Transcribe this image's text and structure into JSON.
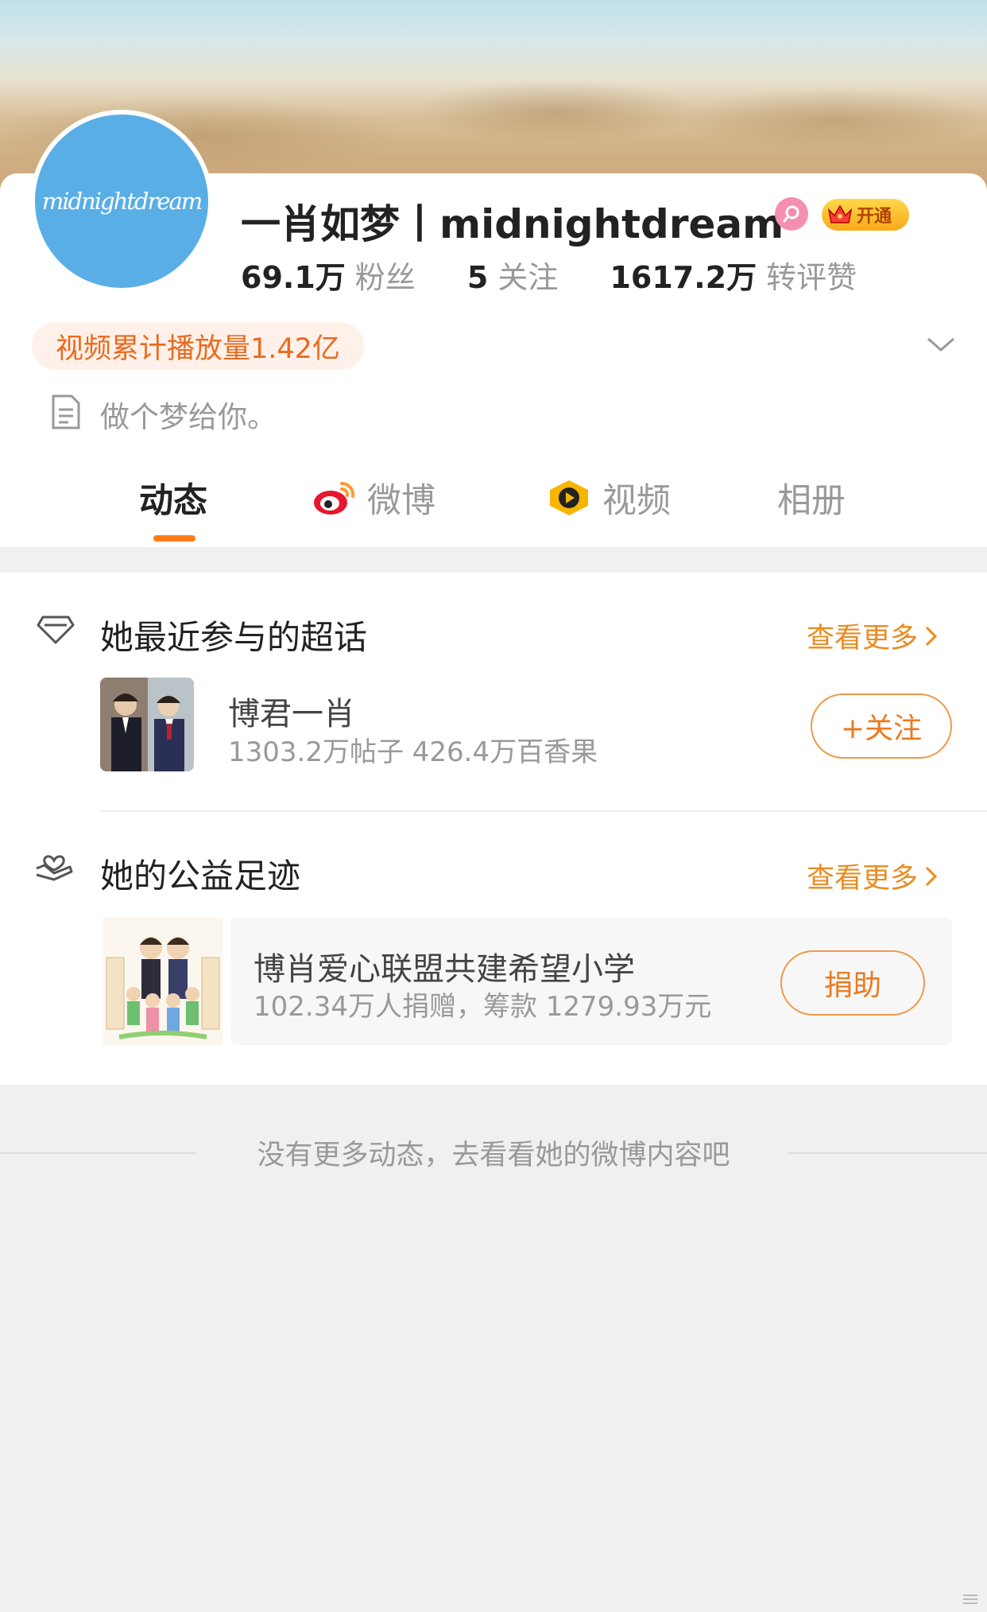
{
  "profile": {
    "avatar_text": "midnightdream",
    "username": "一肖如梦丨midnightdream",
    "gender_icon": "female-icon",
    "vip_label": "开通",
    "stats": [
      {
        "value": "69.1万",
        "label": "粉丝"
      },
      {
        "value": "5",
        "label": "关注"
      },
      {
        "value": "1617.2万",
        "label": "转评赞"
      }
    ],
    "video_views": "视频累计播放量1.42亿",
    "bio": "做个梦给你。"
  },
  "tabs": [
    {
      "label": "动态",
      "icon": null,
      "active": true
    },
    {
      "label": "微博",
      "icon": "weibo-icon",
      "active": false
    },
    {
      "label": "视频",
      "icon": "video-play-icon",
      "active": false
    },
    {
      "label": "相册",
      "icon": null,
      "active": false
    }
  ],
  "super_topic": {
    "title": "她最近参与的超话",
    "see_more": "查看更多",
    "name": "博君一肖",
    "stats": "1303.2万帖子  426.4万百香果",
    "follow_label": "+关注"
  },
  "charity": {
    "title": "她的公益足迹",
    "see_more": "查看更多",
    "name": "博肖爱心联盟共建希望小学",
    "stats": "102.34万人捐赠，筹款 1279.93万元",
    "donate_label": "捐助"
  },
  "footer": {
    "text": "没有更多动态，去看看她的微博内容吧"
  },
  "colors": {
    "accent": "#ff7d1a",
    "link": "#ea8a1f",
    "avatar_bg": "#5aaee6"
  }
}
